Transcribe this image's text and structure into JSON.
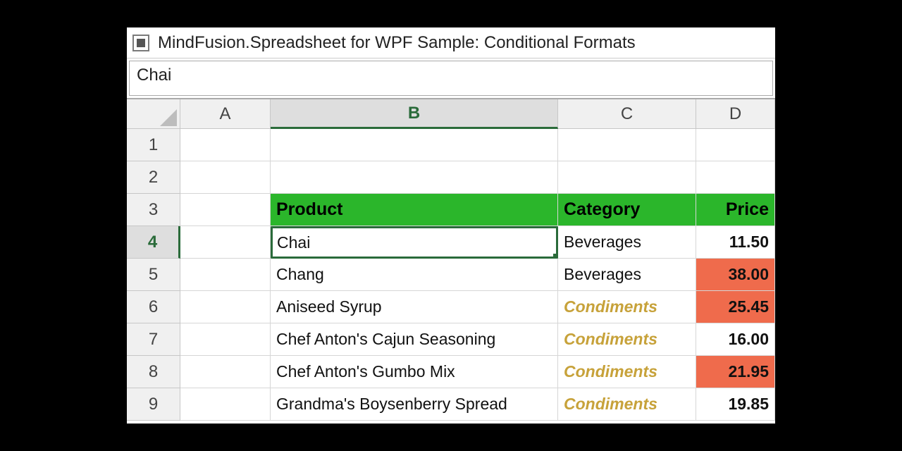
{
  "title": "MindFusion.Spreadsheet for WPF Sample: Conditional Formats",
  "formula_bar": {
    "value": "Chai"
  },
  "columns": [
    "A",
    "B",
    "C",
    "D"
  ],
  "selected_column": "B",
  "selected_row": "4",
  "rows": [
    "1",
    "2",
    "3",
    "4",
    "5",
    "6",
    "7",
    "8",
    "9"
  ],
  "header": {
    "product": "Product",
    "category": "Category",
    "price": "Price"
  },
  "data": [
    {
      "product": "Chai",
      "category": "Beverages",
      "price": "11.50",
      "cat_cond": false,
      "price_hl": false
    },
    {
      "product": "Chang",
      "category": "Beverages",
      "price": "38.00",
      "cat_cond": false,
      "price_hl": true
    },
    {
      "product": "Aniseed Syrup",
      "category": "Condiments",
      "price": "25.45",
      "cat_cond": true,
      "price_hl": true
    },
    {
      "product": "Chef Anton's Cajun Seasoning",
      "category": "Condiments",
      "price": "16.00",
      "cat_cond": true,
      "price_hl": false
    },
    {
      "product": "Chef Anton's Gumbo Mix",
      "category": "Condiments",
      "price": "21.95",
      "cat_cond": true,
      "price_hl": true
    },
    {
      "product": "Grandma's Boysenberry Spread",
      "category": "Condiments",
      "price": "19.85",
      "cat_cond": true,
      "price_hl": false
    }
  ],
  "selected_cell": {
    "col": "B",
    "row": 4
  },
  "colors": {
    "header_bg": "#2bb62b",
    "highlight_bg": "#ef6b4c",
    "cond_text": "#c7a23a",
    "selection": "#2a6b3a"
  }
}
